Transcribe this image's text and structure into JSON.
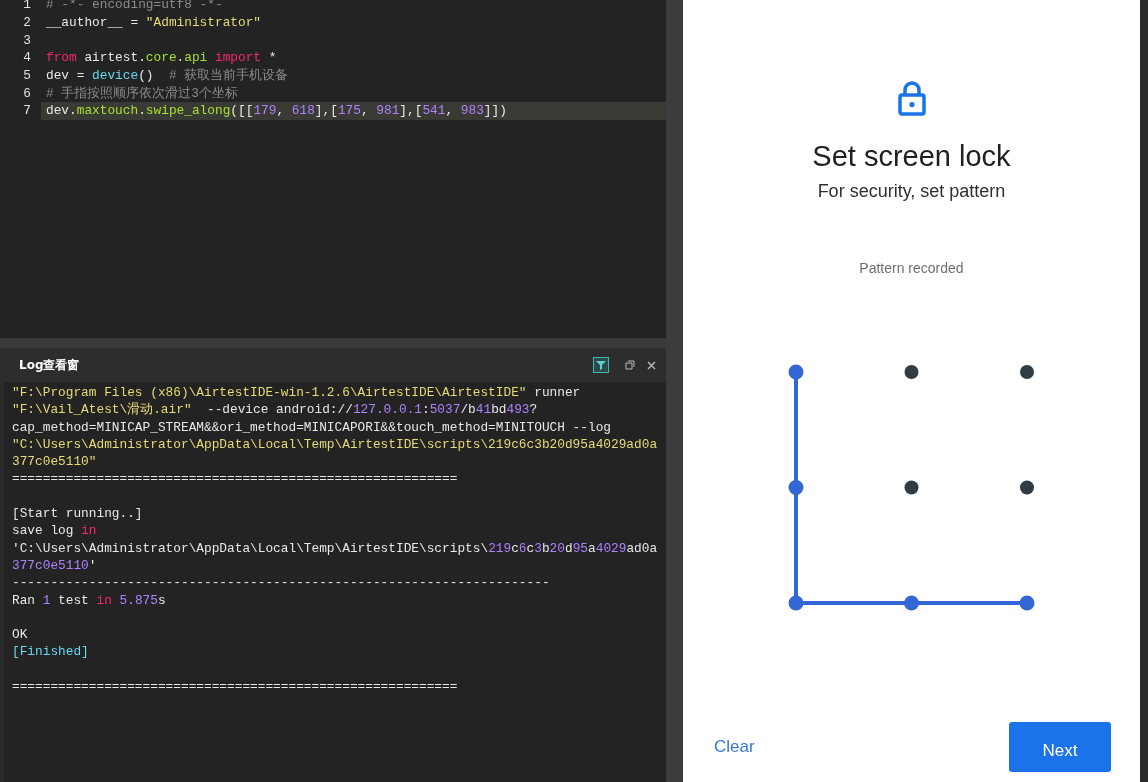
{
  "editor": {
    "lines": [
      {
        "number": "1",
        "selected": false,
        "tokens": [
          {
            "kind": "comment",
            "text": "# -*- encoding=utf8 -*-"
          }
        ]
      },
      {
        "number": "2",
        "selected": false,
        "tokens": [
          {
            "kind": "plain",
            "text": "__author__ = "
          },
          {
            "kind": "string",
            "text": "\"Administrator\""
          }
        ]
      },
      {
        "number": "3",
        "selected": false
      },
      {
        "number": "4",
        "selected": false,
        "tokens": [
          {
            "kind": "keyword",
            "text": "from"
          },
          {
            "kind": "plain",
            "text": " airtest."
          },
          {
            "kind": "green",
            "text": "core"
          },
          {
            "kind": "plain",
            "text": "."
          },
          {
            "kind": "green",
            "text": "api"
          },
          {
            "kind": "keyword",
            "text": " import"
          },
          {
            "kind": "plain",
            "text": " *"
          }
        ]
      },
      {
        "number": "5",
        "selected": false,
        "tokens": [
          {
            "kind": "plain",
            "text": "dev = "
          },
          {
            "kind": "cyan",
            "text": "device"
          },
          {
            "kind": "plain",
            "text": "()  "
          },
          {
            "kind": "comment",
            "text": "# 获取当前手机设备"
          }
        ]
      },
      {
        "number": "6",
        "selected": false,
        "tokens": [
          {
            "kind": "comment",
            "text": "# 手指按照顺序依次滑过3个坐标"
          }
        ]
      },
      {
        "number": "7",
        "selected": true,
        "tokens": [
          {
            "kind": "plain",
            "text": "dev."
          },
          {
            "kind": "green",
            "text": "maxtouch"
          },
          {
            "kind": "plain",
            "text": "."
          },
          {
            "kind": "green",
            "text": "swipe_along"
          },
          {
            "kind": "plain",
            "text": "([["
          },
          {
            "kind": "number",
            "text": "179"
          },
          {
            "kind": "plain",
            "text": ", "
          },
          {
            "kind": "number",
            "text": "618"
          },
          {
            "kind": "plain",
            "text": "],["
          },
          {
            "kind": "number",
            "text": "175"
          },
          {
            "kind": "plain",
            "text": ", "
          },
          {
            "kind": "number",
            "text": "981"
          },
          {
            "kind": "plain",
            "text": "],["
          },
          {
            "kind": "number",
            "text": "541"
          },
          {
            "kind": "plain",
            "text": ", "
          },
          {
            "kind": "number",
            "text": "983"
          },
          {
            "kind": "plain",
            "text": "]])"
          }
        ]
      }
    ]
  },
  "log": {
    "title": "Log查看窗",
    "lines": [
      {
        "kind": "text",
        "tokens": [
          {
            "kind": "string",
            "text": "\"F:\\Program Files (x86)\\AirtestIDE-win-1.2.6\\AirtestIDE\\AirtestIDE\""
          },
          {
            "kind": "plain",
            "text": " runner"
          }
        ]
      },
      {
        "kind": "text",
        "tokens": [
          {
            "kind": "string",
            "text": "\"F:\\Vail_Atest\\滑动.air\""
          },
          {
            "kind": "plain",
            "text": "  --device android://"
          },
          {
            "kind": "number",
            "text": "127.0.0.1"
          },
          {
            "kind": "plain",
            "text": ":"
          },
          {
            "kind": "number",
            "text": "5037"
          },
          {
            "kind": "plain",
            "text": "/b"
          },
          {
            "kind": "number",
            "text": "41"
          },
          {
            "kind": "plain",
            "text": "bd"
          },
          {
            "kind": "number",
            "text": "493"
          },
          {
            "kind": "plain",
            "text": "?"
          }
        ]
      },
      {
        "kind": "text",
        "tokens": [
          {
            "kind": "plain",
            "text": "cap_method=MINICAP_STREAM&&ori_method=MINICAPORI&&touch_method=MINITOUCH --log"
          }
        ]
      },
      {
        "kind": "text",
        "tokens": [
          {
            "kind": "string",
            "text": "\"C:\\Users\\Administrator\\AppData\\Local\\Temp\\AirtestIDE\\scripts\\219c6c3b20d95a4029ad0a"
          }
        ]
      },
      {
        "kind": "text",
        "tokens": [
          {
            "kind": "string",
            "text": "377c0e5110\""
          }
        ]
      },
      {
        "kind": "text",
        "tokens": [
          {
            "kind": "plain",
            "text": "=========================================================="
          }
        ]
      },
      {
        "kind": "blank"
      },
      {
        "kind": "text",
        "tokens": [
          {
            "kind": "plain",
            "text": "[Start running..]"
          }
        ]
      },
      {
        "kind": "text",
        "tokens": [
          {
            "kind": "plain",
            "text": "save log "
          },
          {
            "kind": "keyword",
            "text": "in"
          }
        ]
      },
      {
        "kind": "text",
        "tokens": [
          {
            "kind": "plain",
            "text": "'C:\\Users\\Administrator\\AppData\\Local\\Temp\\AirtestIDE\\scripts\\"
          },
          {
            "kind": "number",
            "text": "219"
          },
          {
            "kind": "plain",
            "text": "c"
          },
          {
            "kind": "number",
            "text": "6"
          },
          {
            "kind": "plain",
            "text": "c"
          },
          {
            "kind": "number",
            "text": "3"
          },
          {
            "kind": "plain",
            "text": "b"
          },
          {
            "kind": "number",
            "text": "20"
          },
          {
            "kind": "plain",
            "text": "d"
          },
          {
            "kind": "number",
            "text": "95"
          },
          {
            "kind": "plain",
            "text": "a"
          },
          {
            "kind": "number",
            "text": "4029"
          },
          {
            "kind": "plain",
            "text": "ad0a"
          }
        ]
      },
      {
        "kind": "text",
        "tokens": [
          {
            "kind": "number",
            "text": "377c0e5110"
          },
          {
            "kind": "plain",
            "text": "'"
          }
        ]
      },
      {
        "kind": "text",
        "tokens": [
          {
            "kind": "plain",
            "text": "----------------------------------------------------------------------"
          }
        ]
      },
      {
        "kind": "text",
        "tokens": [
          {
            "kind": "plain",
            "text": "Ran "
          },
          {
            "kind": "number",
            "text": "1"
          },
          {
            "kind": "plain",
            "text": " test "
          },
          {
            "kind": "keyword",
            "text": "in"
          },
          {
            "kind": "number",
            "text": " 5.875"
          },
          {
            "kind": "plain",
            "text": "s"
          }
        ]
      },
      {
        "kind": "blank"
      },
      {
        "kind": "text",
        "tokens": [
          {
            "kind": "plain",
            "text": "OK"
          }
        ]
      },
      {
        "kind": "text",
        "tokens": [
          {
            "kind": "cyan",
            "text": "[Finished]"
          }
        ]
      },
      {
        "kind": "blank"
      },
      {
        "kind": "text",
        "tokens": [
          {
            "kind": "plain",
            "text": "=========================================================="
          }
        ]
      }
    ]
  },
  "phone": {
    "title": "Set screen lock",
    "subtitle": "For security, set pattern",
    "status": "Pattern recorded",
    "pattern": [
      {
        "selected": true
      },
      {
        "selected": false
      },
      {
        "selected": false
      },
      {
        "selected": true
      },
      {
        "selected": false
      },
      {
        "selected": false
      },
      {
        "selected": true
      },
      {
        "selected": true
      },
      {
        "selected": true
      }
    ],
    "buttons": [
      {
        "kind": "text",
        "label": "Clear"
      },
      {
        "kind": "filled",
        "label": "Next"
      }
    ]
  }
}
